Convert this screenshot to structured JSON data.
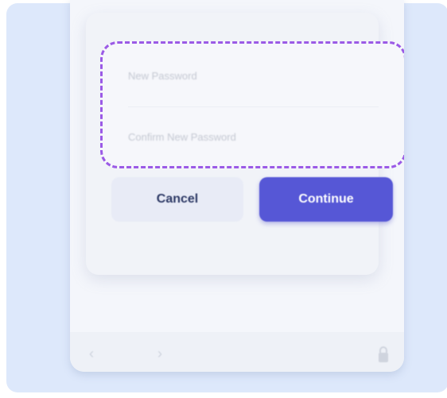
{
  "dialog": {
    "new_password_placeholder": "New Password",
    "confirm_password_placeholder": "Confirm New Password",
    "cancel_label": "Cancel",
    "continue_label": "Continue"
  },
  "icons": {
    "back": "chevron-left-icon",
    "forward": "chevron-right-icon",
    "lock": "lock-icon"
  },
  "colors": {
    "highlight": "#9b5ae6",
    "continue": "#5657d6",
    "cancel": "#e8ebf6",
    "background": "#dde8fb"
  }
}
